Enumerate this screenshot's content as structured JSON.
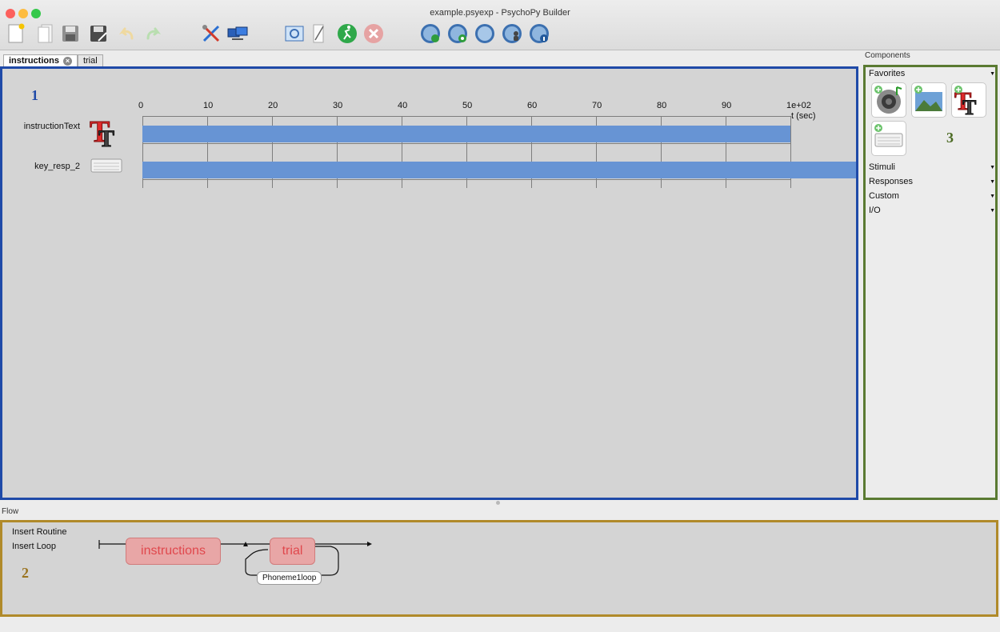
{
  "window": {
    "title": "example.psyexp - PsychoPy Builder"
  },
  "colors": {
    "routine_border": "#1f4aa8",
    "components_border": "#5a7a32",
    "flow_border": "#b08a2a",
    "timeline_bar": "#6794d4",
    "routine_box": "#e8a6a6",
    "routine_text": "#e0484d"
  },
  "toolbar": {
    "icons": [
      "new-file-icon",
      "open-file-icon",
      "save-icon",
      "save-as-icon",
      "undo-icon",
      "redo-icon",
      "preferences-icon",
      "monitor-center-icon",
      "experiment-settings-icon",
      "code-icon",
      "run-icon",
      "stop-icon",
      "pavlovia-sync-icon",
      "pavlovia-search-icon",
      "pavlovia-globe-icon",
      "pavlovia-user-icon",
      "pavlovia-info-icon"
    ]
  },
  "tabs": [
    {
      "label": "instructions",
      "active": true,
      "closable": true
    },
    {
      "label": "trial",
      "active": false
    }
  ],
  "routine": {
    "panel_number": "1",
    "time_unit": "t (sec)",
    "ticks": [
      "0",
      "10",
      "20",
      "30",
      "40",
      "50",
      "60",
      "70",
      "80",
      "90",
      "1e+02"
    ],
    "components": [
      {
        "name": "instructionText",
        "icon": "text-component-icon",
        "start": 0,
        "stop": 100
      },
      {
        "name": "key_resp_2",
        "icon": "keyboard-component-icon",
        "start": 0,
        "stop": null
      }
    ]
  },
  "components_panel": {
    "header": "Components",
    "panel_number": "3",
    "favorites_label": "Favorites",
    "favorites": [
      "sound-component-icon",
      "image-component-icon",
      "text-component-icon",
      "keyboard-component-icon"
    ],
    "categories": [
      "Stimuli",
      "Responses",
      "Custom",
      "I/O"
    ]
  },
  "flow": {
    "header": "Flow",
    "panel_number": "2",
    "insert_routine": "Insert Routine",
    "insert_loop": "Insert Loop",
    "routines": [
      "instructions",
      "trial"
    ],
    "loop_name": "Phoneme1loop"
  }
}
